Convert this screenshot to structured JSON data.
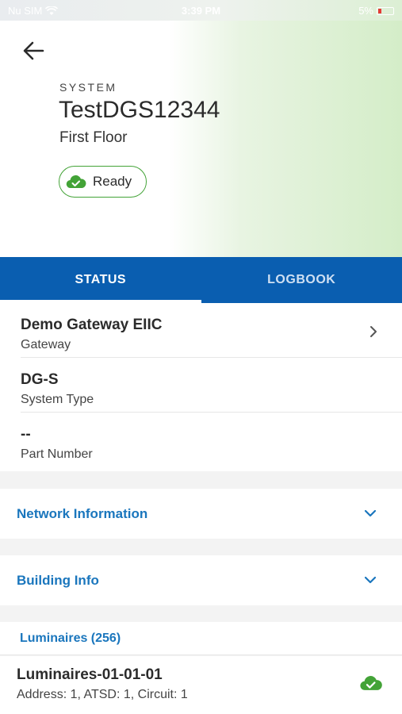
{
  "status_bar": {
    "carrier": "Nu SIM",
    "time": "3:39 PM",
    "battery": "5%"
  },
  "header": {
    "system_label": "SYSTEM",
    "system_name": "TestDGS12344",
    "floor": "First Floor",
    "status": "Ready"
  },
  "tabs": [
    {
      "label": "STATUS",
      "active": true
    },
    {
      "label": "LOGBOOK",
      "active": false
    }
  ],
  "info": [
    {
      "value": "Demo Gateway EIIC",
      "label": "Gateway"
    },
    {
      "value": "DG-S",
      "label": "System Type"
    },
    {
      "value": "--",
      "label": "Part Number"
    }
  ],
  "sections": {
    "network": "Network Information",
    "building": "Building Info"
  },
  "luminaires": {
    "header": "Luminaires (256)",
    "items": [
      {
        "name": "Luminaires-01-01-01",
        "address": "Address: 1, ATSD: 1, Circuit: 1"
      }
    ]
  },
  "colors": {
    "brand_blue": "#0a5eb0",
    "link_blue": "#1a76bd",
    "ok_green": "#43a337"
  },
  "icons": [
    "back-arrow-icon",
    "cloud-check-icon",
    "chevron-right-icon",
    "chevron-down-icon",
    "wifi-icon",
    "battery-icon"
  ]
}
